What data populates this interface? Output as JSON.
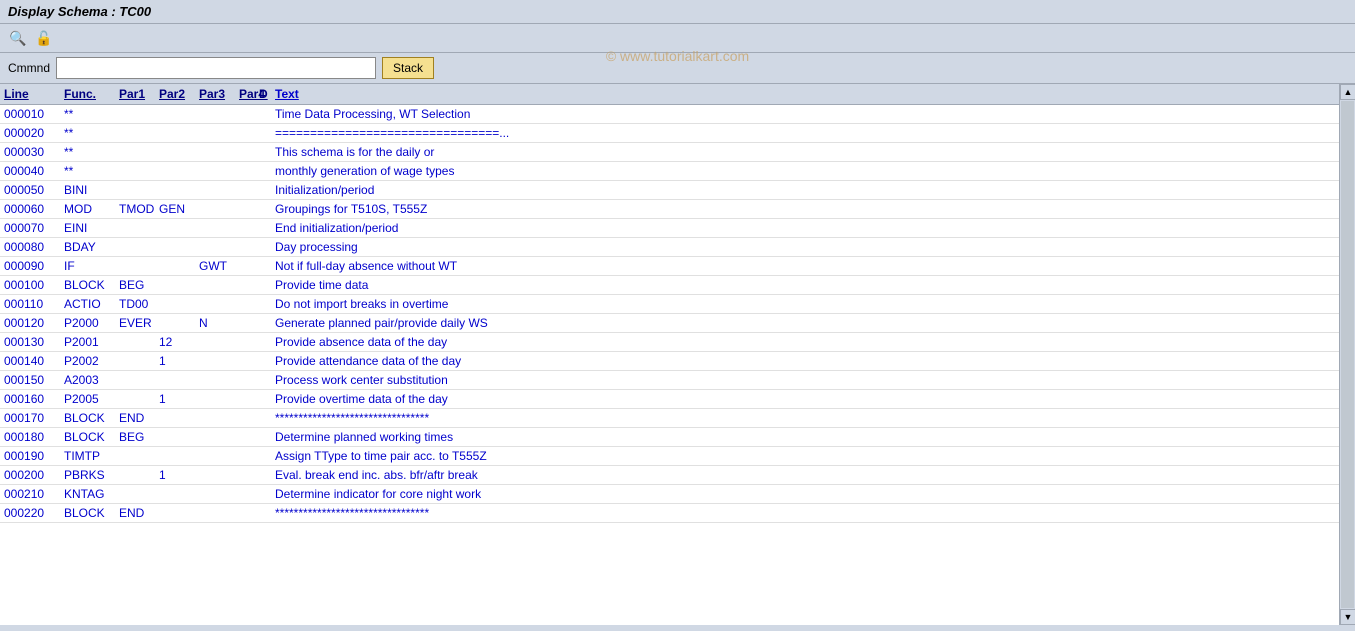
{
  "title": "Display Schema : TC00",
  "watermark": "© www.tutorialkart.com",
  "toolbar": {
    "icons": [
      "fingerprint-icon",
      "lock-icon"
    ]
  },
  "command": {
    "label": "Cmmnd",
    "placeholder": "",
    "stack_button": "Stack"
  },
  "table": {
    "headers": [
      "Line",
      "Func.",
      "Par1",
      "Par2",
      "Par3",
      "Par4",
      "D",
      "Text"
    ],
    "rows": [
      {
        "line": "000010",
        "func": "**",
        "par1": "",
        "par2": "",
        "par3": "",
        "par4": "",
        "d": "",
        "text": "Time Data Processing, WT Selection"
      },
      {
        "line": "000020",
        "func": "**",
        "par1": "",
        "par2": "",
        "par3": "",
        "par4": "",
        "d": "",
        "text": "================================..."
      },
      {
        "line": "000030",
        "func": "**",
        "par1": "",
        "par2": "",
        "par3": "",
        "par4": "",
        "d": "",
        "text": "This schema is for the daily or"
      },
      {
        "line": "000040",
        "func": "**",
        "par1": "",
        "par2": "",
        "par3": "",
        "par4": "",
        "d": "",
        "text": "monthly generation of wage types"
      },
      {
        "line": "000050",
        "func": "BINI",
        "par1": "",
        "par2": "",
        "par3": "",
        "par4": "",
        "d": "",
        "text": "Initialization/period"
      },
      {
        "line": "000060",
        "func": "MOD",
        "par1": "TMOD",
        "par2": "GEN",
        "par3": "",
        "par4": "",
        "d": "",
        "text": "Groupings for T510S, T555Z"
      },
      {
        "line": "000070",
        "func": "EINI",
        "par1": "",
        "par2": "",
        "par3": "",
        "par4": "",
        "d": "",
        "text": "End initialization/period"
      },
      {
        "line": "000080",
        "func": "BDAY",
        "par1": "",
        "par2": "",
        "par3": "",
        "par4": "",
        "d": "",
        "text": "Day processing"
      },
      {
        "line": "000090",
        "func": "IF",
        "par1": "",
        "par2": "",
        "par3": "GWT",
        "par4": "",
        "d": "",
        "text": "Not if full-day absence without WT"
      },
      {
        "line": "000100",
        "func": "BLOCK",
        "par1": "BEG",
        "par2": "",
        "par3": "",
        "par4": "",
        "d": "",
        "text": "Provide time data"
      },
      {
        "line": "000110",
        "func": "ACTIO",
        "par1": "TD00",
        "par2": "",
        "par3": "",
        "par4": "",
        "d": "",
        "text": "Do not import breaks in overtime"
      },
      {
        "line": "000120",
        "func": "P2000",
        "par1": "EVER",
        "par2": "",
        "par3": "N",
        "par4": "",
        "d": "",
        "text": "Generate planned pair/provide daily WS"
      },
      {
        "line": "000130",
        "func": "P2001",
        "par1": "",
        "par2": "12",
        "par3": "",
        "par4": "",
        "d": "",
        "text": "Provide absence data of the day"
      },
      {
        "line": "000140",
        "func": "P2002",
        "par1": "",
        "par2": "1",
        "par3": "",
        "par4": "",
        "d": "",
        "text": "Provide attendance data of the day"
      },
      {
        "line": "000150",
        "func": "A2003",
        "par1": "",
        "par2": "",
        "par3": "",
        "par4": "",
        "d": "",
        "text": "Process work center substitution"
      },
      {
        "line": "000160",
        "func": "P2005",
        "par1": "",
        "par2": "1",
        "par3": "",
        "par4": "",
        "d": "",
        "text": "Provide overtime data of the day"
      },
      {
        "line": "000170",
        "func": "BLOCK",
        "par1": "END",
        "par2": "",
        "par3": "",
        "par4": "",
        "d": "",
        "text": "*********************************"
      },
      {
        "line": "000180",
        "func": "BLOCK",
        "par1": "BEG",
        "par2": "",
        "par3": "",
        "par4": "",
        "d": "",
        "text": "Determine planned working times"
      },
      {
        "line": "000190",
        "func": "TIMTP",
        "par1": "",
        "par2": "",
        "par3": "",
        "par4": "",
        "d": "",
        "text": "Assign TType to time pair acc. to T555Z"
      },
      {
        "line": "000200",
        "func": "PBRKS",
        "par1": "",
        "par2": "1",
        "par3": "",
        "par4": "",
        "d": "",
        "text": "Eval. break end inc. abs. bfr/aftr break"
      },
      {
        "line": "000210",
        "func": "KNTAG",
        "par1": "",
        "par2": "",
        "par3": "",
        "par4": "",
        "d": "",
        "text": "Determine indicator for core night work"
      },
      {
        "line": "000220",
        "func": "BLOCK",
        "par1": "END",
        "par2": "",
        "par3": "",
        "par4": "",
        "d": "",
        "text": "*********************************"
      }
    ]
  }
}
